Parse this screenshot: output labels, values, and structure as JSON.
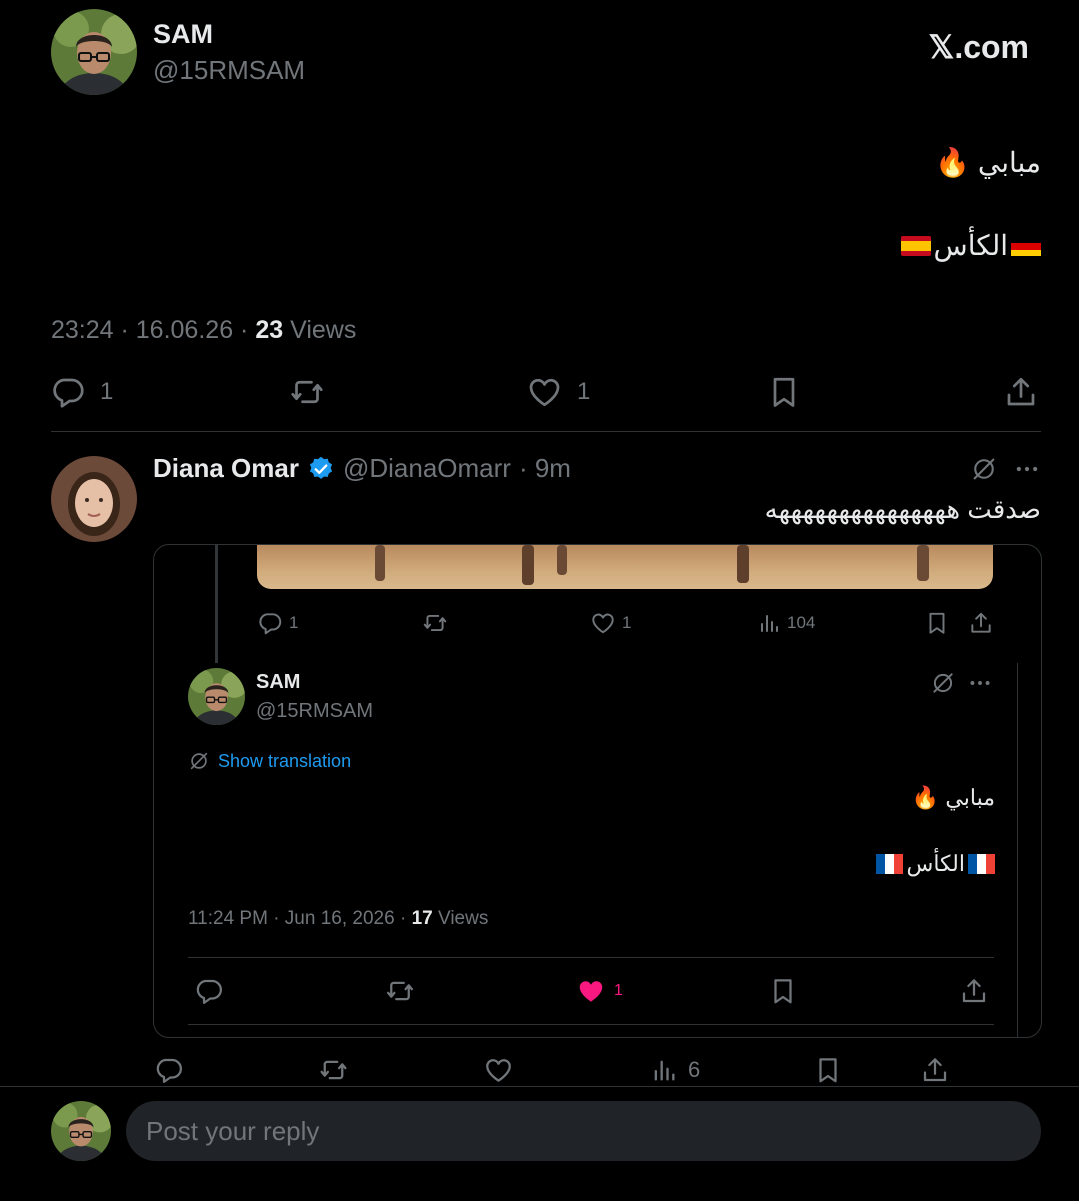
{
  "main_tweet": {
    "display_name": "SAM",
    "handle": "@15RMSAM",
    "brand": "𝕏.com",
    "line1": "مبابي 🔥",
    "line2": "الكأس",
    "timestamp": "23:24 · 16.06.26 ·",
    "views_count": "23",
    "views_label": "Views",
    "replies": "1",
    "likes": "1"
  },
  "reply": {
    "display_name": "Diana Omar",
    "handle": "@DianaOmarr",
    "time": "· 9m",
    "text": "صدقت هههههههههههههههه",
    "verified": true,
    "views": "6"
  },
  "quoted": {
    "prev_replies": "1",
    "prev_likes": "1",
    "prev_views": "104",
    "display_name": "SAM",
    "handle": "@15RMSAM",
    "show_translation": "Show translation",
    "line1": "مبابي 🔥",
    "line2": "الكأس",
    "timestamp": "11:24 PM · Jun 16, 2026 ·",
    "views_count": "17",
    "views_label": "Views",
    "likes": "1"
  },
  "composer": {
    "placeholder": "Post your reply"
  },
  "colors": {
    "background": "#000000",
    "text": "#e7e9ea",
    "muted": "#71767b",
    "link": "#1d9bf0",
    "like": "#f91880",
    "verified": "#1d9bf0",
    "divider": "#2f3336"
  },
  "icons": [
    "reply-icon",
    "retweet-icon",
    "heart-icon",
    "bookmark-icon",
    "share-icon",
    "views-icon",
    "grok-icon",
    "more-icon",
    "verified-icon",
    "fire-emoji"
  ]
}
